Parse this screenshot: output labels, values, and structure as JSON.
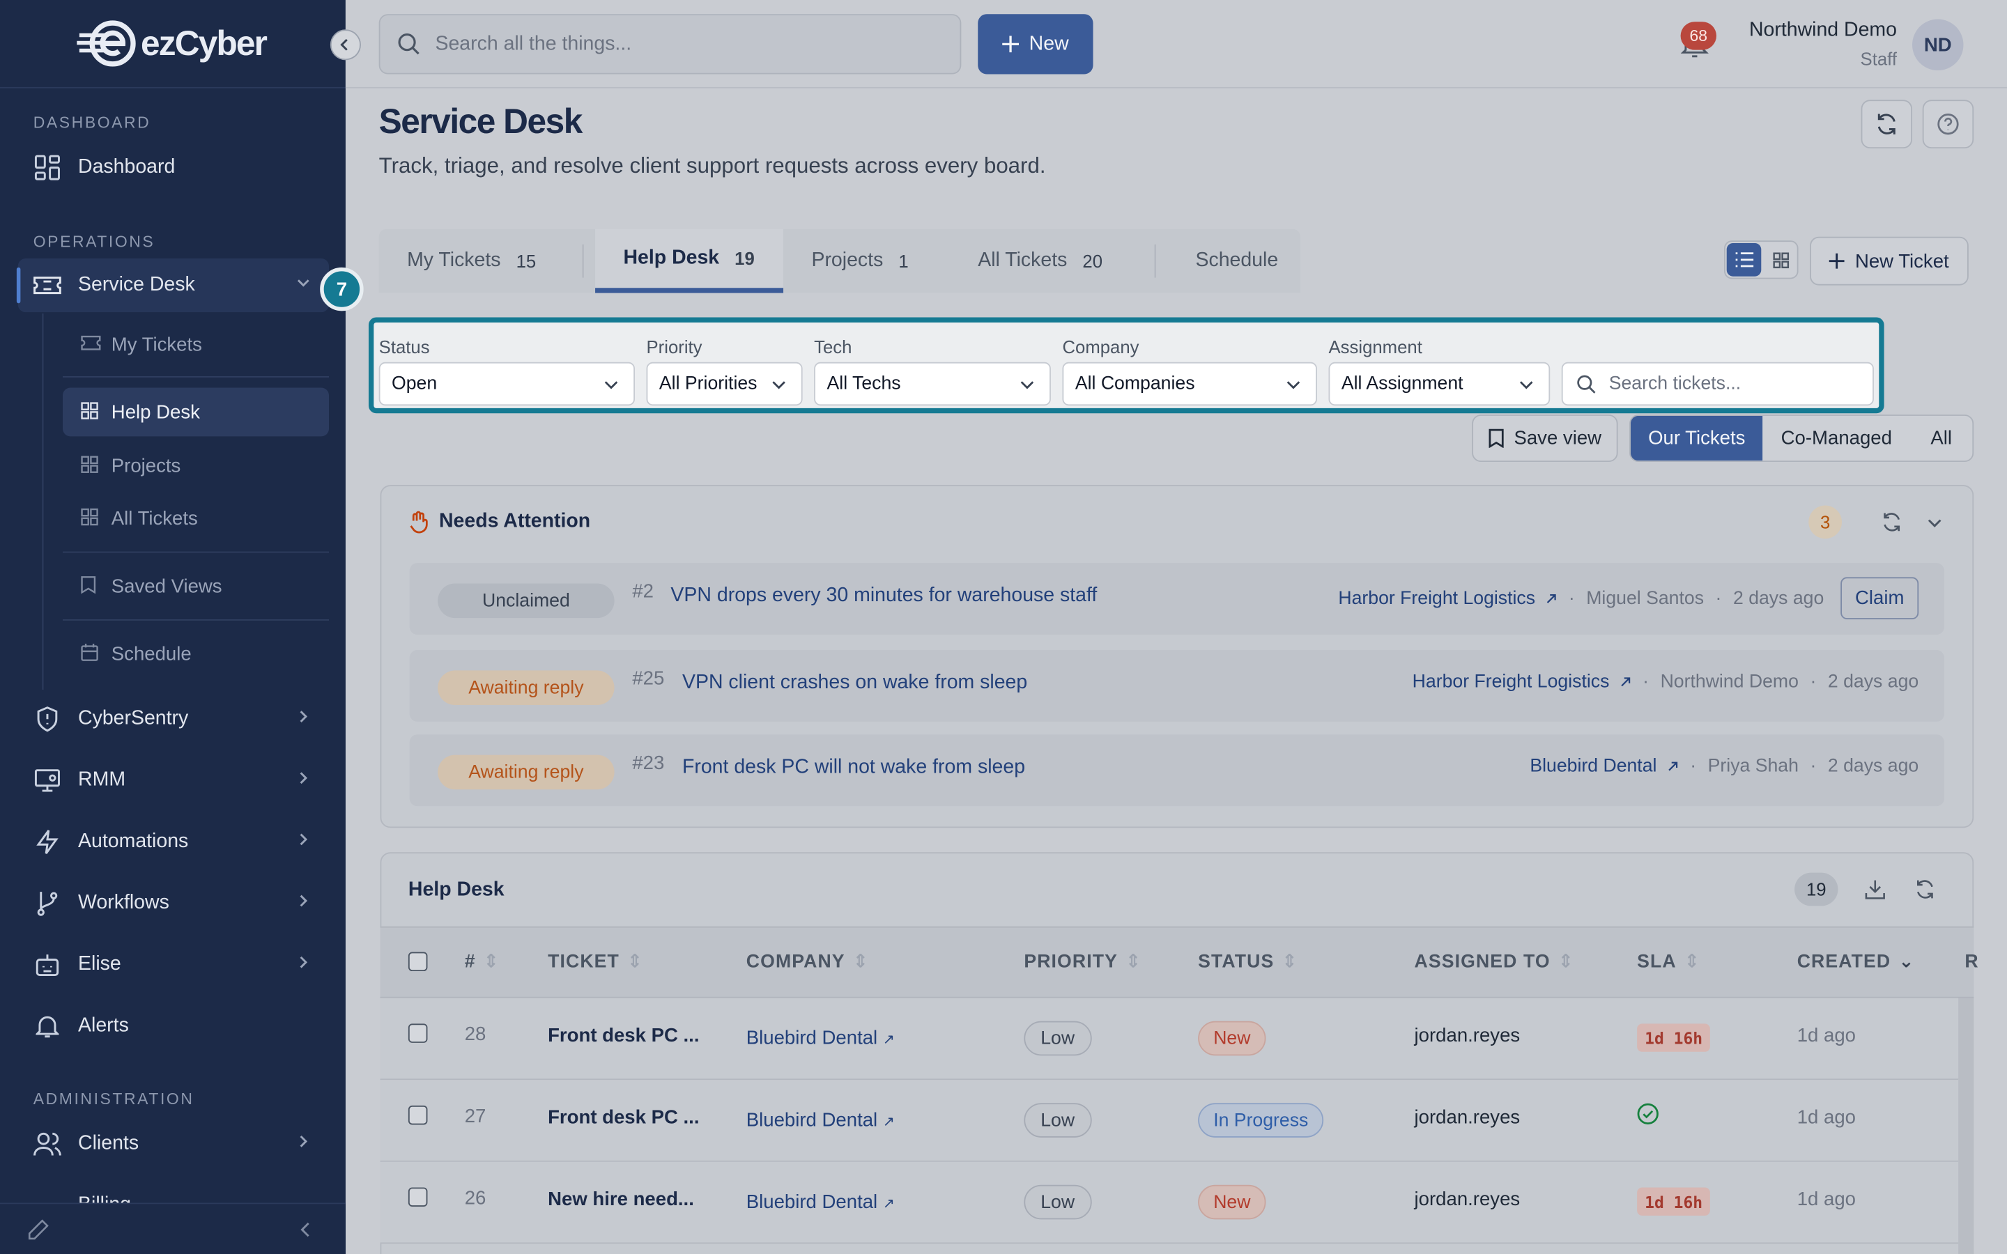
{
  "brand": {
    "logo_text": "ezCyber"
  },
  "sidebar": {
    "sections": {
      "dashboard": "DASHBOARD",
      "operations": "OPERATIONS",
      "administration": "ADMINISTRATION"
    },
    "items": {
      "dashboard": "Dashboard",
      "service_desk": "Service Desk",
      "cybersentry": "CyberSentry",
      "rmm": "RMM",
      "automations": "Automations",
      "workflows": "Workflows",
      "elise": "Elise",
      "alerts": "Alerts",
      "clients": "Clients",
      "billing": "Billing"
    },
    "sub_items": {
      "my_tickets": "My Tickets",
      "help_desk": "Help Desk",
      "projects": "Projects",
      "all_tickets": "All Tickets",
      "saved_views": "Saved Views",
      "schedule": "Schedule"
    },
    "step_badge": "7"
  },
  "topbar": {
    "search_placeholder": "Search all the things...",
    "new_label": "New",
    "notifications_count": "68",
    "user_name": "Northwind Demo",
    "user_role": "Staff",
    "avatar_initials": "ND"
  },
  "page": {
    "title": "Service Desk",
    "subtitle": "Track, triage, and resolve client support requests across every board."
  },
  "tabs": [
    {
      "label": "My Tickets",
      "count": "15"
    },
    {
      "label": "Help Desk",
      "count": "19"
    },
    {
      "label": "Projects",
      "count": "1"
    },
    {
      "label": "All Tickets",
      "count": "20"
    },
    {
      "label": "Schedule",
      "count": ""
    }
  ],
  "toolbar": {
    "new_ticket_label": "New Ticket",
    "save_view_label": "Save view"
  },
  "filters": {
    "status": {
      "label": "Status",
      "value": "Open"
    },
    "priority": {
      "label": "Priority",
      "value": "All Priorities"
    },
    "tech": {
      "label": "Tech",
      "value": "All Techs"
    },
    "company": {
      "label": "Company",
      "value": "All Companies"
    },
    "assignment": {
      "label": "Assignment",
      "value": "All Assignment"
    },
    "search_placeholder": "Search tickets..."
  },
  "scope": {
    "our": "Our Tickets",
    "comanaged": "Co-Managed",
    "all": "All"
  },
  "attention": {
    "title": "Needs Attention",
    "count": "3",
    "rows": [
      {
        "status": "Unclaimed",
        "num": "#2",
        "title": "VPN drops every 30 minutes for warehouse staff",
        "company": "Harbor Freight Logistics",
        "person": "Miguel Santos",
        "age": "2 days ago",
        "action": "Claim"
      },
      {
        "status": "Awaiting reply",
        "num": "#25",
        "title": "VPN client crashes on wake from sleep",
        "company": "Harbor Freight Logistics",
        "person": "Northwind Demo",
        "age": "2 days ago"
      },
      {
        "status": "Awaiting reply",
        "num": "#23",
        "title": "Front desk PC will not wake from sleep",
        "company": "Bluebird Dental",
        "person": "Priya Shah",
        "age": "2 days ago"
      }
    ]
  },
  "helpdesk": {
    "title": "Help Desk",
    "count": "19",
    "columns": {
      "num": "#",
      "ticket": "TICKET",
      "company": "COMPANY",
      "priority": "PRIORITY",
      "status": "STATUS",
      "assigned": "ASSIGNED TO",
      "sla": "SLA",
      "created": "CREATED",
      "more": "R"
    },
    "rows": [
      {
        "num": "28",
        "ticket": "Front desk PC ...",
        "company": "Bluebird Dental",
        "priority": "Low",
        "status": "New",
        "assigned": "jordan.reyes",
        "sla": "1d 16h",
        "created": "1d ago"
      },
      {
        "num": "27",
        "ticket": "Front desk PC ...",
        "company": "Bluebird Dental",
        "priority": "Low",
        "status": "In Progress",
        "assigned": "jordan.reyes",
        "sla": "",
        "created": "1d ago"
      },
      {
        "num": "26",
        "ticket": "New hire need...",
        "company": "Bluebird Dental",
        "priority": "Low",
        "status": "New",
        "assigned": "jordan.reyes",
        "sla": "1d 16h",
        "created": "1d ago"
      }
    ]
  }
}
